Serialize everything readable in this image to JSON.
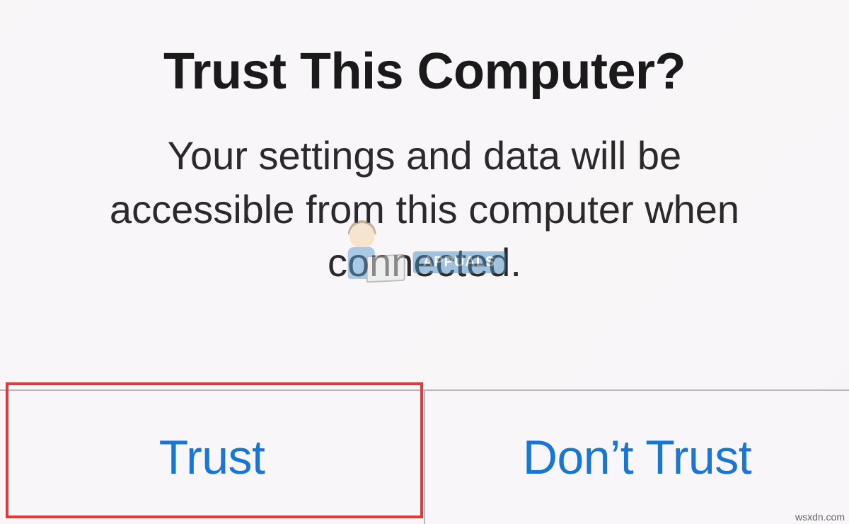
{
  "dialog": {
    "title": "Trust This Computer?",
    "message": "Your settings and data will be accessible from this computer when connected.",
    "trust_label": "Trust",
    "dont_trust_label": "Don’t Trust"
  },
  "watermark": {
    "label": "APPUALS"
  },
  "source": "wsxdn.com",
  "colors": {
    "button_text": "#1976d2",
    "highlight": "#e53935"
  }
}
